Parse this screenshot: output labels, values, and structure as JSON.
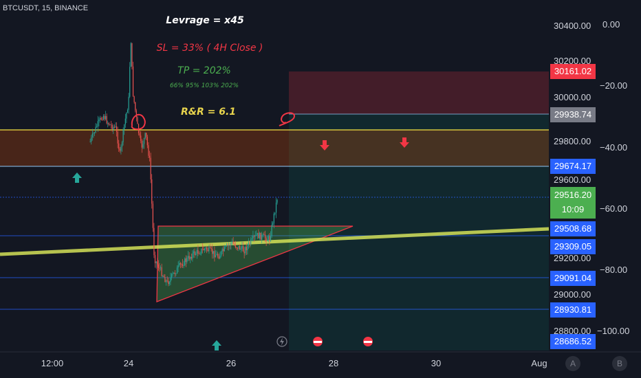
{
  "symbol": "BTCUSDT, 15, BINANCE",
  "annotations": {
    "leverage": "Levrage = x45",
    "sl": "SL = 33% ( 4H Close )",
    "tp": "TP = 202%",
    "tp_levels": "66%   95%   103%   202%",
    "rr": "R&R = 6.1"
  },
  "colors": {
    "background": "#131722",
    "sl_text": "#f23645",
    "tp_text": "#4caf50",
    "rr_text": "#e8d44d",
    "blue_tag": "#2962ff",
    "red_tag": "#f23645",
    "gray_tag": "#787b86",
    "green_tag": "#4caf50"
  },
  "chart_data": {
    "type": "line",
    "title": "",
    "price_axis": [
      "30400.00",
      "30200.00",
      "30000.00",
      "29800.00",
      "29600.00",
      "29200.00",
      "29000.00",
      "28800.00"
    ],
    "right_axis": [
      "0.00",
      "−20.00",
      "−40.00",
      "−60.00",
      "−80.00",
      "−100.00"
    ],
    "time_axis": [
      "12:00",
      "24",
      "26",
      "28",
      "30",
      "Aug"
    ],
    "price_tags": [
      {
        "value": "30161.02",
        "color": "red"
      },
      {
        "value": "29938.74",
        "color": "gray"
      },
      {
        "value": "29674.17",
        "color": "blue"
      },
      {
        "value": "29516.20",
        "countdown": "10:09",
        "color": "green"
      },
      {
        "value": "29508.68",
        "color": "blue"
      },
      {
        "value": "29309.05",
        "color": "blue"
      },
      {
        "value": "29091.04",
        "color": "blue"
      },
      {
        "value": "28930.81",
        "color": "blue"
      },
      {
        "value": "28686.52",
        "color": "blue"
      }
    ],
    "price_path": [
      [
        "07-23 06:00",
        29790
      ],
      [
        "07-23 09:00",
        29870
      ],
      [
        "07-23 12:00",
        29930
      ],
      [
        "07-23 15:00",
        29880
      ],
      [
        "07-23 18:00",
        29860
      ],
      [
        "07-23 20:00",
        29720
      ],
      [
        "07-23 22:00",
        29880
      ],
      [
        "07-24 00:00",
        30000
      ],
      [
        "07-24 01:00",
        30340
      ],
      [
        "07-24 02:00",
        30050
      ],
      [
        "07-24 04:00",
        29880
      ],
      [
        "07-24 06:00",
        29760
      ],
      [
        "07-24 08:00",
        29830
      ],
      [
        "07-24 10:00",
        29680
      ],
      [
        "07-24 12:00",
        29180
      ],
      [
        "07-24 18:00",
        29050
      ],
      [
        "07-25 00:00",
        29140
      ],
      [
        "07-25 06:00",
        29200
      ],
      [
        "07-25 12:00",
        29230
      ],
      [
        "07-25 18:00",
        29190
      ],
      [
        "07-26 00:00",
        29260
      ],
      [
        "07-26 06:00",
        29220
      ],
      [
        "07-26 12:00",
        29300
      ],
      [
        "07-26 18:00",
        29280
      ],
      [
        "07-26 20:00",
        29400
      ],
      [
        "07-26 22:00",
        29516
      ]
    ]
  },
  "buttons": {
    "a": "A",
    "b": "B"
  }
}
